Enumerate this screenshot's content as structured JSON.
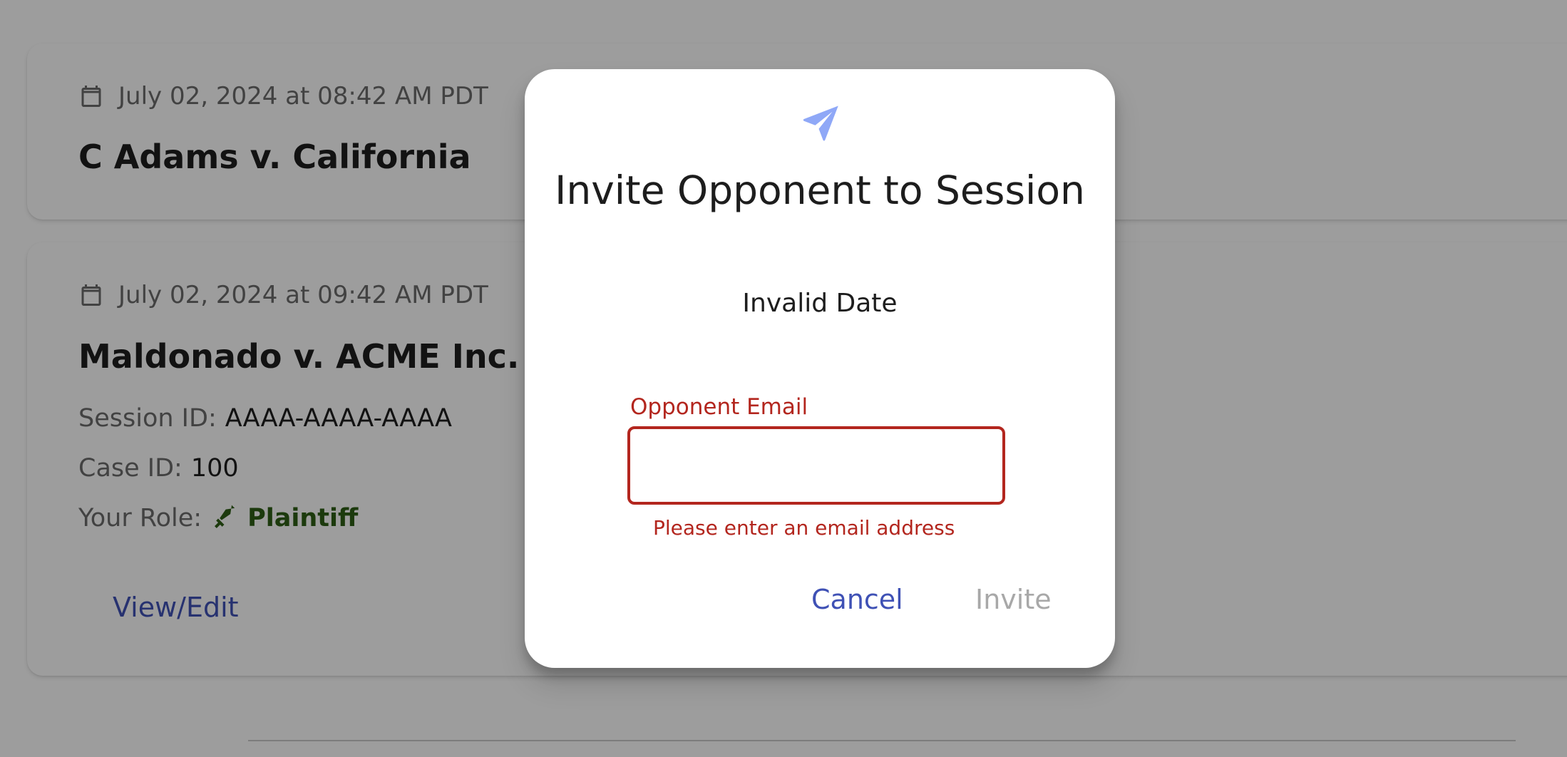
{
  "sessions": [
    {
      "date": "July 02, 2024 at 08:42 AM PDT",
      "title": "C Adams v. California"
    },
    {
      "date": "July 02, 2024 at 09:42 AM PDT",
      "title": "Maldonado v. ACME Inc.",
      "session_id_label": "Session ID:",
      "session_id": "AAAA-AAAA-AAAA",
      "case_id_label": "Case ID:",
      "case_id": "100",
      "role_label": "Your Role:",
      "role": "Plaintiff",
      "role_icon": "sword-icon",
      "action_label": "View/Edit"
    }
  ],
  "dialog": {
    "icon": "send-icon",
    "title": "Invite Opponent to Session",
    "date": "Invalid Date",
    "email_label": "Opponent Email",
    "email_value": "",
    "email_error": "Please enter an email address",
    "cancel_label": "Cancel",
    "invite_label": "Invite"
  },
  "colors": {
    "accent": "#3f51b5",
    "error": "#b3261e",
    "role": "#2e5e16",
    "disabled": "#a8a8a8",
    "send_icon": "#8fa8f7"
  }
}
